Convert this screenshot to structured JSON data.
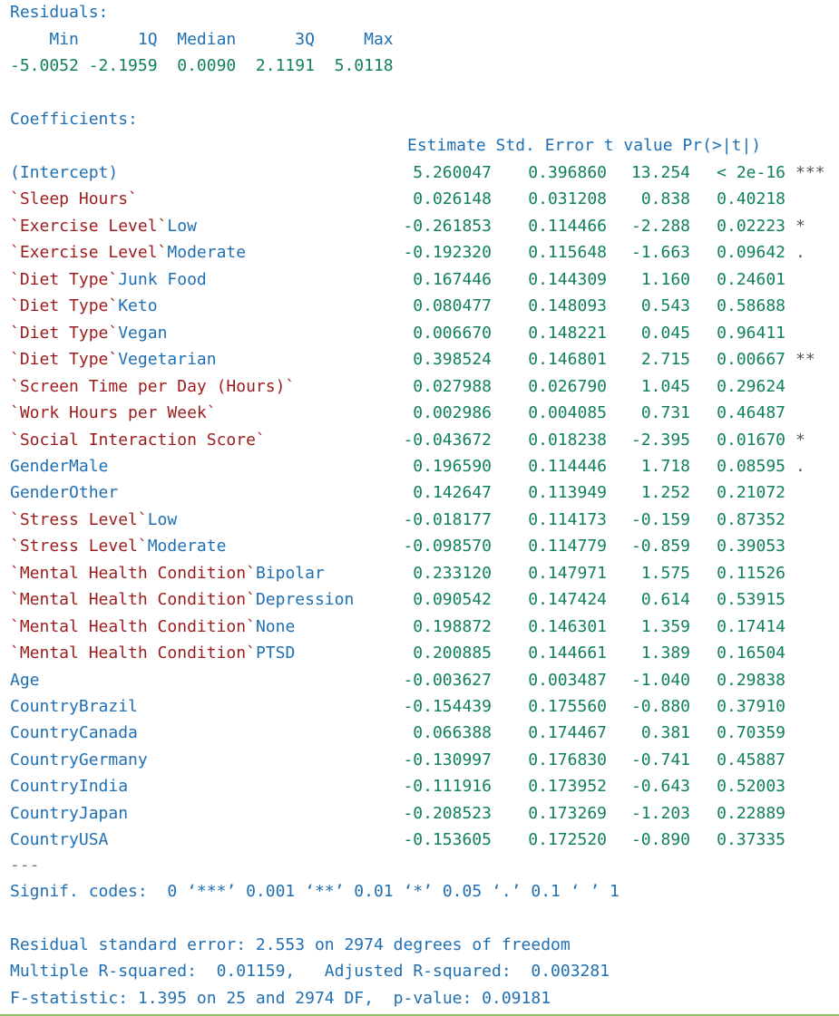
{
  "residuals": {
    "title": "Residuals:",
    "header": "    Min      1Q  Median      3Q     Max",
    "values": "-5.0052 -2.1959  0.0090  2.1191  5.0118"
  },
  "coefficients": {
    "title": "Coefficients:",
    "header": "Estimate Std. Error t value Pr(>|t|)",
    "rows": [
      {
        "term": "(Intercept)",
        "estimate": "5.260047",
        "std_error": "0.396860",
        "t_value": "13.254",
        "p_value": "< 2e-16",
        "signif": "***"
      },
      {
        "term": "`Sleep Hours`",
        "estimate": "0.026148",
        "std_error": "0.031208",
        "t_value": "0.838",
        "p_value": "0.40218",
        "signif": ""
      },
      {
        "term": "`Exercise Level`Low",
        "estimate": "-0.261853",
        "std_error": "0.114466",
        "t_value": "-2.288",
        "p_value": "0.02223",
        "signif": "*"
      },
      {
        "term": "`Exercise Level`Moderate",
        "estimate": "-0.192320",
        "std_error": "0.115648",
        "t_value": "-1.663",
        "p_value": "0.09642",
        "signif": "."
      },
      {
        "term": "`Diet Type`Junk Food",
        "estimate": "0.167446",
        "std_error": "0.144309",
        "t_value": "1.160",
        "p_value": "0.24601",
        "signif": ""
      },
      {
        "term": "`Diet Type`Keto",
        "estimate": "0.080477",
        "std_error": "0.148093",
        "t_value": "0.543",
        "p_value": "0.58688",
        "signif": ""
      },
      {
        "term": "`Diet Type`Vegan",
        "estimate": "0.006670",
        "std_error": "0.148221",
        "t_value": "0.045",
        "p_value": "0.96411",
        "signif": ""
      },
      {
        "term": "`Diet Type`Vegetarian",
        "estimate": "0.398524",
        "std_error": "0.146801",
        "t_value": "2.715",
        "p_value": "0.00667",
        "signif": "**"
      },
      {
        "term": "`Screen Time per Day (Hours)`",
        "estimate": "0.027988",
        "std_error": "0.026790",
        "t_value": "1.045",
        "p_value": "0.29624",
        "signif": ""
      },
      {
        "term": "`Work Hours per Week`",
        "estimate": "0.002986",
        "std_error": "0.004085",
        "t_value": "0.731",
        "p_value": "0.46487",
        "signif": ""
      },
      {
        "term": "`Social Interaction Score`",
        "estimate": "-0.043672",
        "std_error": "0.018238",
        "t_value": "-2.395",
        "p_value": "0.01670",
        "signif": "*"
      },
      {
        "term": "GenderMale",
        "estimate": "0.196590",
        "std_error": "0.114446",
        "t_value": "1.718",
        "p_value": "0.08595",
        "signif": "."
      },
      {
        "term": "GenderOther",
        "estimate": "0.142647",
        "std_error": "0.113949",
        "t_value": "1.252",
        "p_value": "0.21072",
        "signif": ""
      },
      {
        "term": "`Stress Level`Low",
        "estimate": "-0.018177",
        "std_error": "0.114173",
        "t_value": "-0.159",
        "p_value": "0.87352",
        "signif": ""
      },
      {
        "term": "`Stress Level`Moderate",
        "estimate": "-0.098570",
        "std_error": "0.114779",
        "t_value": "-0.859",
        "p_value": "0.39053",
        "signif": ""
      },
      {
        "term": "`Mental Health Condition`Bipolar",
        "estimate": "0.233120",
        "std_error": "0.147971",
        "t_value": "1.575",
        "p_value": "0.11526",
        "signif": ""
      },
      {
        "term": "`Mental Health Condition`Depression",
        "estimate": "0.090542",
        "std_error": "0.147424",
        "t_value": "0.614",
        "p_value": "0.53915",
        "signif": ""
      },
      {
        "term": "`Mental Health Condition`None",
        "estimate": "0.198872",
        "std_error": "0.146301",
        "t_value": "1.359",
        "p_value": "0.17414",
        "signif": ""
      },
      {
        "term": "`Mental Health Condition`PTSD",
        "estimate": "0.200885",
        "std_error": "0.144661",
        "t_value": "1.389",
        "p_value": "0.16504",
        "signif": ""
      },
      {
        "term": "Age",
        "estimate": "-0.003627",
        "std_error": "0.003487",
        "t_value": "-1.040",
        "p_value": "0.29838",
        "signif": ""
      },
      {
        "term": "CountryBrazil",
        "estimate": "-0.154439",
        "std_error": "0.175560",
        "t_value": "-0.880",
        "p_value": "0.37910",
        "signif": ""
      },
      {
        "term": "CountryCanada",
        "estimate": "0.066388",
        "std_error": "0.174467",
        "t_value": "0.381",
        "p_value": "0.70359",
        "signif": ""
      },
      {
        "term": "CountryGermany",
        "estimate": "-0.130997",
        "std_error": "0.176830",
        "t_value": "-0.741",
        "p_value": "0.45887",
        "signif": ""
      },
      {
        "term": "CountryIndia",
        "estimate": "-0.111916",
        "std_error": "0.173952",
        "t_value": "-0.643",
        "p_value": "0.52003",
        "signif": ""
      },
      {
        "term": "CountryJapan",
        "estimate": "-0.208523",
        "std_error": "0.173269",
        "t_value": "-1.203",
        "p_value": "0.22889",
        "signif": ""
      },
      {
        "term": "CountryUSA",
        "estimate": "-0.153605",
        "std_error": "0.172520",
        "t_value": "-0.890",
        "p_value": "0.37335",
        "signif": ""
      }
    ],
    "separator": "---",
    "signif_codes": "Signif. codes:  0 ‘***’ 0.001 ‘**’ 0.01 ‘*’ 0.05 ‘.’ 0.1 ‘ ’ 1"
  },
  "summary": {
    "residual_se": "Residual standard error: 2.553 on 2974 degrees of freedom",
    "r_squared": "Multiple R-squared:  0.01159,\tAdjusted R-squared:  0.003281 ",
    "f_statistic": "F-statistic: 1.395 on 25 and 2974 DF,  p-value: 0.09181"
  },
  "colors": {
    "label_blue": "#1f6fb2",
    "number_green": "#11805c",
    "backtick_red": "#9b1c1c",
    "rule_green": "#8dc46a"
  }
}
